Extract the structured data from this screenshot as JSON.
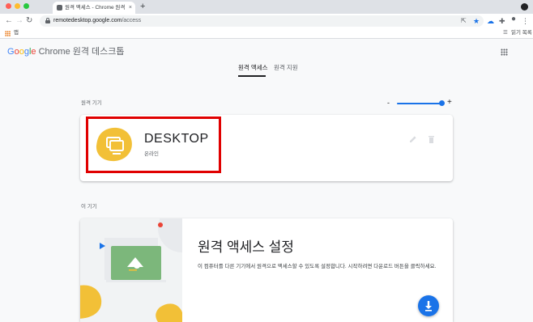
{
  "browser": {
    "tab_title": "원격 액세스 - Chrome 원격 데스크톱",
    "tab_close": "×",
    "new_tab": "+",
    "url_host": "remotedesktop.google.com",
    "url_path": "/access",
    "bookmarks_apps_label": "앱",
    "reading_list_label": "읽기 목록"
  },
  "header": {
    "brand_google": [
      "G",
      "o",
      "o",
      "g",
      "l",
      "e"
    ],
    "brand_product": " Chrome 원격 데스크톱"
  },
  "tabs": [
    {
      "label": "원격 액세스",
      "active": true
    },
    {
      "label": "원격 지원",
      "active": false
    }
  ],
  "remote_devices": {
    "section_label": "원격 기기",
    "zoom_minus": "-",
    "zoom_plus": "+",
    "zoom_level": 1.0,
    "device": {
      "name": "DESKTOP",
      "status": "온라인"
    }
  },
  "this_device": {
    "section_label": "이 기기",
    "title": "원격 액세스 설정",
    "description": "이 컴퓨터를 다른 기기에서 원격으로 액세스할 수 있도록 설정합니다. 시작하려면 다운로드 버튼을 클릭하세요."
  },
  "colors": {
    "accent": "#1a73e8",
    "highlight": "#e00000",
    "illustration_yellow": "#f2c037",
    "illustration_green": "#7cb77b"
  },
  "icons": [
    "tab-favicon-icon",
    "back-arrow-icon",
    "forward-arrow-icon",
    "reload-icon",
    "lock-icon",
    "share-icon",
    "star-icon",
    "extension-cloud-icon",
    "puzzle-icon",
    "profile-icon",
    "apps-grid-icon",
    "reading-list-icon",
    "edit-icon",
    "delete-icon",
    "download-icon"
  ]
}
